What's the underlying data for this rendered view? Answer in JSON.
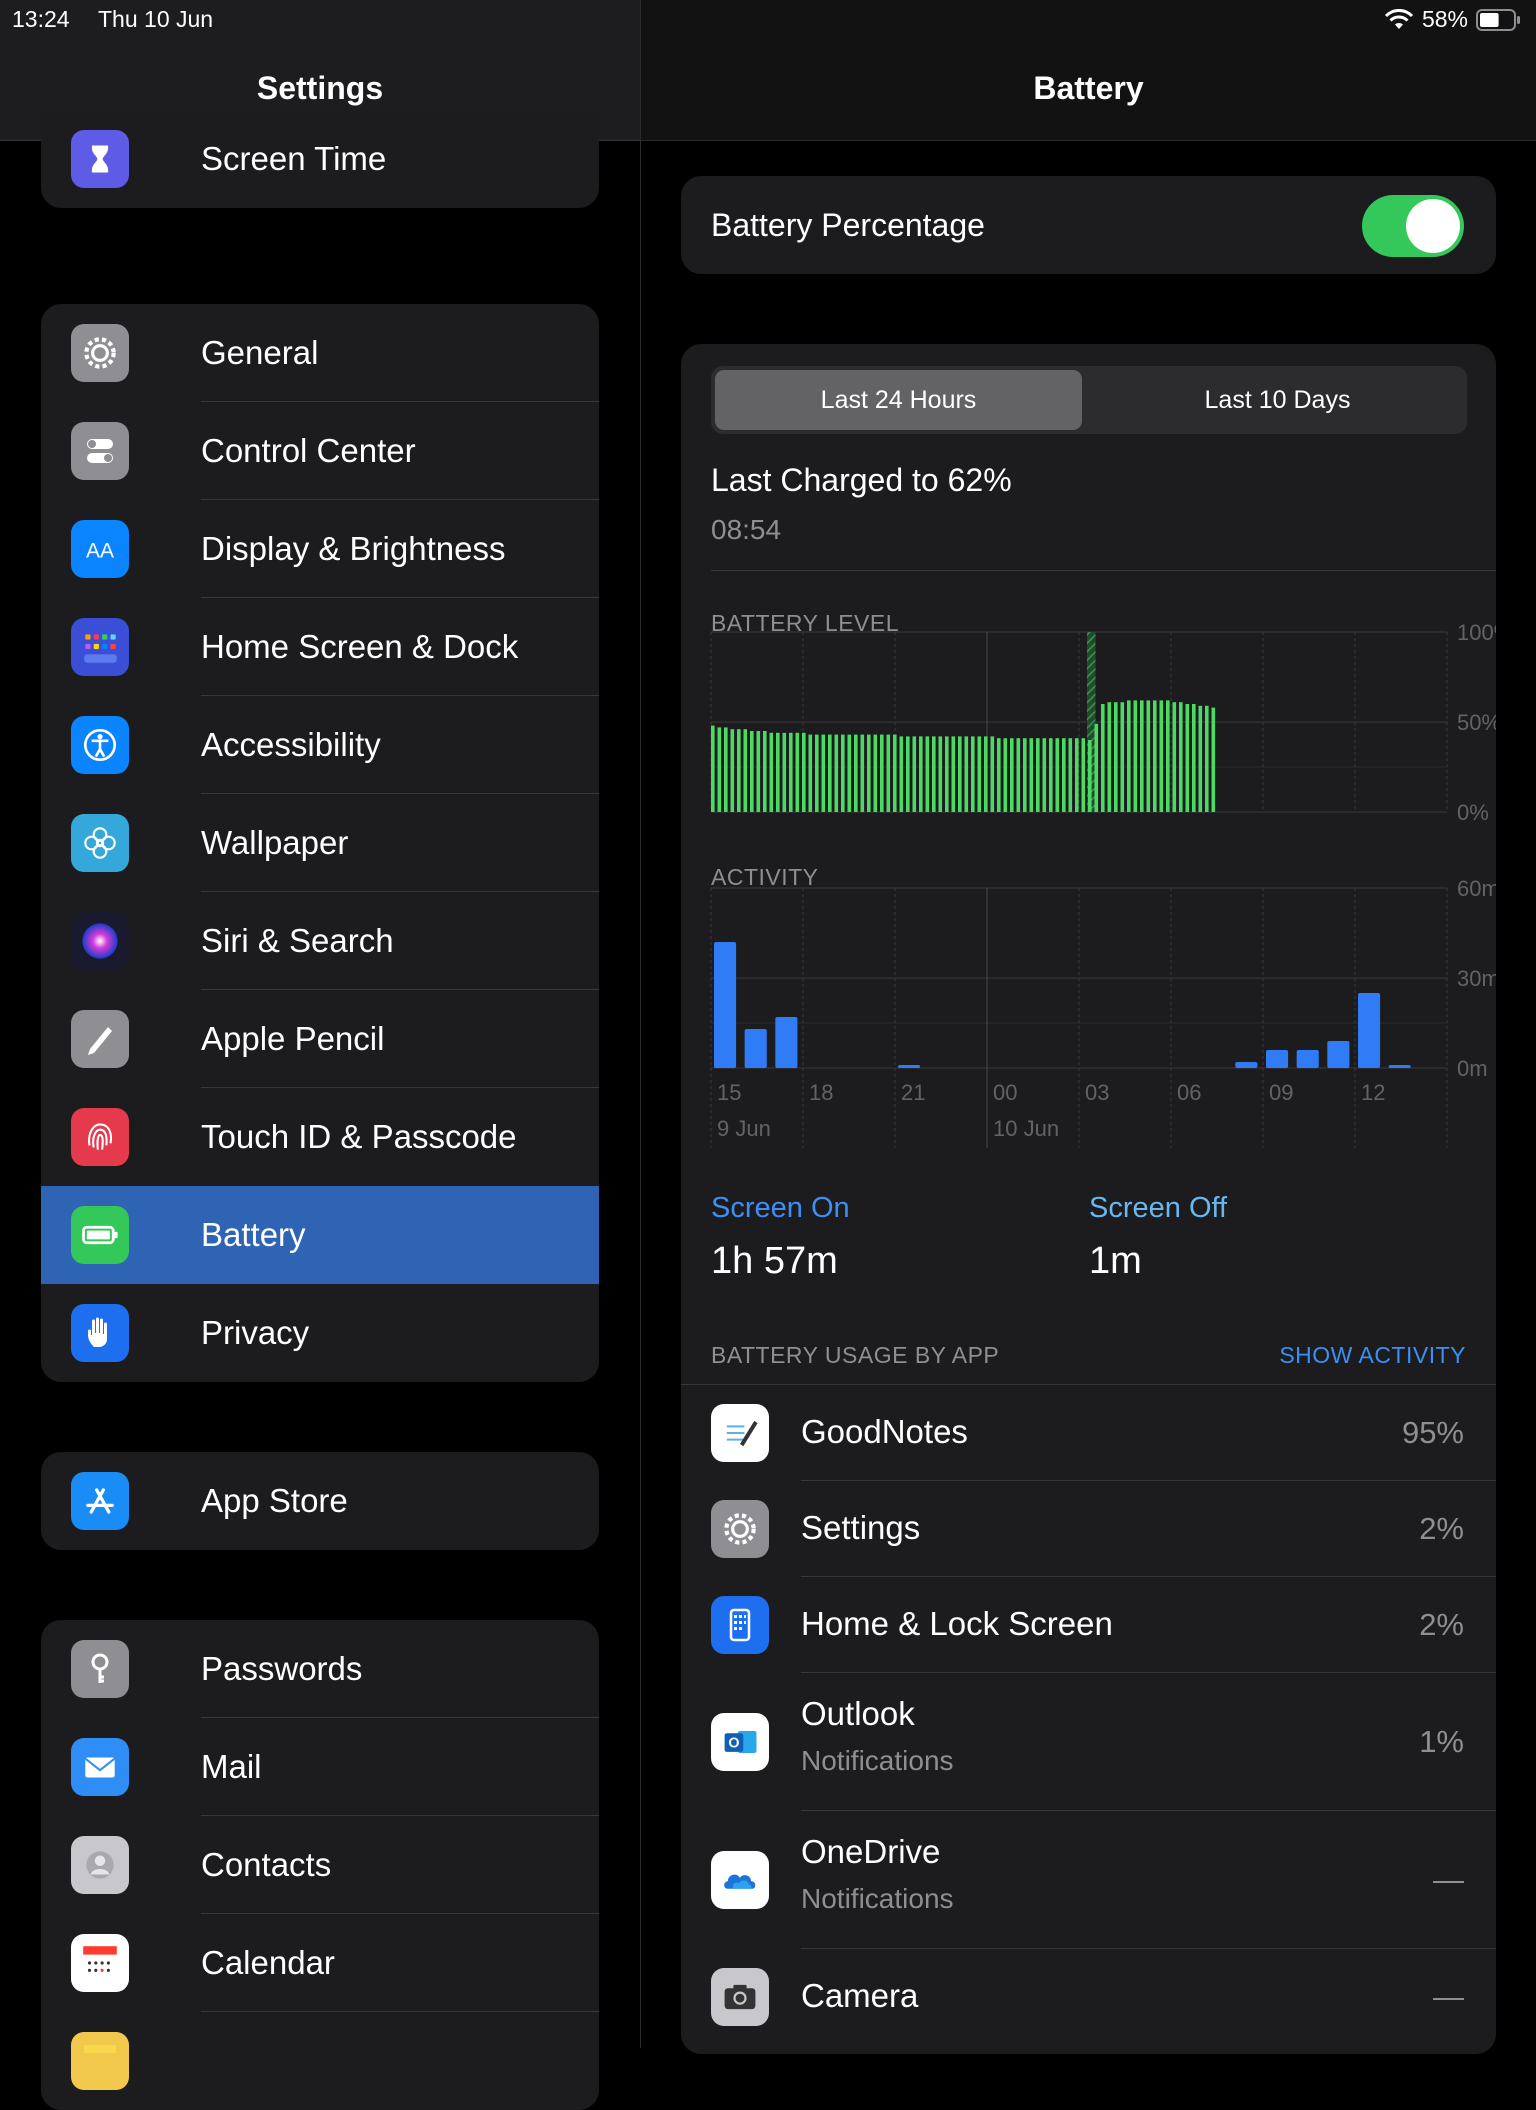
{
  "status": {
    "time": "13:24",
    "date": "Thu 10 Jun",
    "battery": "58%",
    "battery_level": 0.58
  },
  "sidebar": {
    "title": "Settings",
    "groups": [
      [
        {
          "label": "Screen Time",
          "icon": "hourglass-icon",
          "color": "#5e5ce6"
        }
      ],
      [
        {
          "label": "General",
          "icon": "gear-icon",
          "color": "#8e8e93"
        },
        {
          "label": "Control Center",
          "icon": "toggles-icon",
          "color": "#8e8e93"
        },
        {
          "label": "Display & Brightness",
          "icon": "text-size-icon",
          "color": "#0a84ff"
        },
        {
          "label": "Home Screen & Dock",
          "icon": "app-grid-icon",
          "color": "#3a4ed6"
        },
        {
          "label": "Accessibility",
          "icon": "accessibility-icon",
          "color": "#0a84ff"
        },
        {
          "label": "Wallpaper",
          "icon": "flower-icon",
          "color": "#35a8db"
        },
        {
          "label": "Siri & Search",
          "icon": "siri-icon",
          "color": "#1a1a2e"
        },
        {
          "label": "Apple Pencil",
          "icon": "pencil-icon",
          "color": "#8e8e93"
        },
        {
          "label": "Touch ID & Passcode",
          "icon": "fingerprint-icon",
          "color": "#e5394c"
        },
        {
          "label": "Battery",
          "icon": "battery-icon",
          "color": "#34c759",
          "selected": true
        },
        {
          "label": "Privacy",
          "icon": "hand-icon",
          "color": "#1e6ff0"
        }
      ],
      [
        {
          "label": "App Store",
          "icon": "app-store-icon",
          "color": "#1a8cf5"
        }
      ],
      [
        {
          "label": "Passwords",
          "icon": "key-icon",
          "color": "#8e8e93"
        },
        {
          "label": "Mail",
          "icon": "envelope-icon",
          "color": "#2f8ef5"
        },
        {
          "label": "Contacts",
          "icon": "contacts-icon",
          "color": "#c7c7cc"
        },
        {
          "label": "Calendar",
          "icon": "calendar-icon",
          "color": "#ffffff"
        },
        {
          "label": "",
          "icon": "notes-icon",
          "color": "#f2c94c"
        }
      ]
    ]
  },
  "detail": {
    "title": "Battery",
    "battery_percentage_label": "Battery Percentage",
    "battery_percentage_on": true,
    "segments": [
      "Last 24 Hours",
      "Last 10 Days"
    ],
    "active_segment": 0,
    "last_charged": "Last Charged to 62%",
    "last_charged_time": "08:54",
    "level_label": "BATTERY LEVEL",
    "activity_label": "ACTIVITY",
    "screen_on_label": "Screen On",
    "screen_on_value": "1h 57m",
    "screen_off_label": "Screen Off",
    "screen_off_value": "1m",
    "usage_label": "BATTERY USAGE BY APP",
    "show_activity": "SHOW ACTIVITY",
    "apps": [
      {
        "name": "GoodNotes",
        "sub": "",
        "pct": "95%",
        "icon": "goodnotes-icon"
      },
      {
        "name": "Settings",
        "sub": "",
        "pct": "2%",
        "icon": "gear-icon"
      },
      {
        "name": "Home & Lock Screen",
        "sub": "",
        "pct": "2%",
        "icon": "ipad-icon"
      },
      {
        "name": "Outlook",
        "sub": "Notifications",
        "pct": "1%",
        "icon": "outlook-icon"
      },
      {
        "name": "OneDrive",
        "sub": "Notifications",
        "pct": "—",
        "icon": "cloud-icon"
      },
      {
        "name": "Camera",
        "sub": "",
        "pct": "—",
        "icon": "camera-icon"
      }
    ]
  },
  "chart_data": [
    {
      "type": "bar",
      "title": "BATTERY LEVEL",
      "y_ticks": [
        "100%",
        "50%",
        "0%"
      ],
      "ylim": [
        0,
        100
      ],
      "x_ticks": [
        "15",
        "18",
        "21",
        "00",
        "03",
        "06",
        "09",
        "12"
      ],
      "x_sublabels": [
        "9 Jun",
        "10 Jun"
      ],
      "charging_index": 58,
      "values": [
        48,
        47,
        47,
        46,
        46,
        46,
        45,
        45,
        45,
        44,
        44,
        44,
        44,
        44,
        44,
        43,
        43,
        43,
        43,
        43,
        43,
        43,
        43,
        43,
        43,
        43,
        43,
        43,
        43,
        42,
        42,
        42,
        42,
        42,
        42,
        42,
        42,
        42,
        42,
        42,
        42,
        42,
        42,
        42,
        41,
        41,
        41,
        41,
        41,
        41,
        41,
        41,
        41,
        41,
        41,
        41,
        41,
        41,
        40,
        49,
        60,
        61,
        61,
        61,
        62,
        62,
        62,
        62,
        62,
        62,
        62,
        61,
        61,
        60,
        60,
        59,
        59,
        58
      ]
    },
    {
      "type": "bar",
      "title": "ACTIVITY",
      "y_ticks": [
        "60m",
        "30m",
        "0m"
      ],
      "ylim": [
        0,
        60
      ],
      "x_ticks": [
        "15",
        "18",
        "21",
        "00",
        "03",
        "06",
        "09",
        "12"
      ],
      "x_sublabels": [
        "9 Jun",
        "10 Jun"
      ],
      "values": [
        42,
        13,
        17,
        0,
        0,
        0,
        1,
        0,
        0,
        0,
        0,
        0,
        0,
        0,
        0,
        0,
        0,
        2,
        6,
        6,
        9,
        25,
        1
      ]
    }
  ]
}
